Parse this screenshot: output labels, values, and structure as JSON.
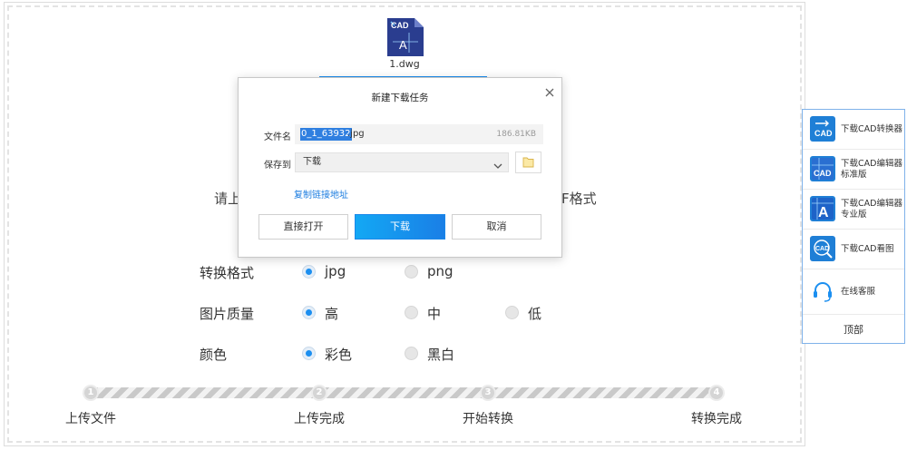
{
  "file": {
    "name": "1.dwg",
    "icon": "cad-file-icon",
    "icon_text": "CAD",
    "icon_letter": "A"
  },
  "page_peek": {
    "left_text": "请上",
    "right_text": "F格式"
  },
  "options": {
    "format": {
      "label": "转换格式",
      "choices": [
        "jpg",
        "png"
      ],
      "selected": "jpg"
    },
    "quality": {
      "label": "图片质量",
      "choices": [
        "高",
        "中",
        "低"
      ],
      "selected": "高"
    },
    "color": {
      "label": "颜色",
      "choices": [
        "彩色",
        "黑白"
      ],
      "selected": "彩色"
    }
  },
  "steps": [
    {
      "num": "1",
      "label": "上传文件"
    },
    {
      "num": "2",
      "label": "上传完成"
    },
    {
      "num": "3",
      "label": "开始转换"
    },
    {
      "num": "4",
      "label": "转换完成"
    }
  ],
  "sidebar": {
    "items": [
      {
        "label": "下载CAD转换器",
        "icon": "cad-converter-icon",
        "icon_text": "CAD"
      },
      {
        "label": "下载CAD编辑器标准版",
        "icon": "cad-editor-standard-icon",
        "icon_text": "CAD"
      },
      {
        "label": "下载CAD编辑器专业版",
        "icon": "cad-editor-pro-icon",
        "icon_text": "A"
      },
      {
        "label": "下载CAD看图",
        "icon": "cad-viewer-icon",
        "icon_text": "CAD"
      },
      {
        "label": "在线客服",
        "icon": "headset-icon",
        "icon_text": ""
      }
    ],
    "top_label": "顶部"
  },
  "dialog": {
    "title": "新建下载任务",
    "filename_label": "文件名",
    "filename_selected": "0_1_63932",
    "filename_ext": ".jpg",
    "file_size": "186.81KB",
    "save_label": "保存到",
    "save_location": "下载",
    "copy_link": "复制链接地址",
    "buttons": {
      "open": "直接打开",
      "download": "下载",
      "cancel": "取消"
    }
  },
  "colors": {
    "accent": "#1c8ff0",
    "sidebar_border": "#7fb2ea",
    "icon_bg": "#1f7fd6"
  }
}
